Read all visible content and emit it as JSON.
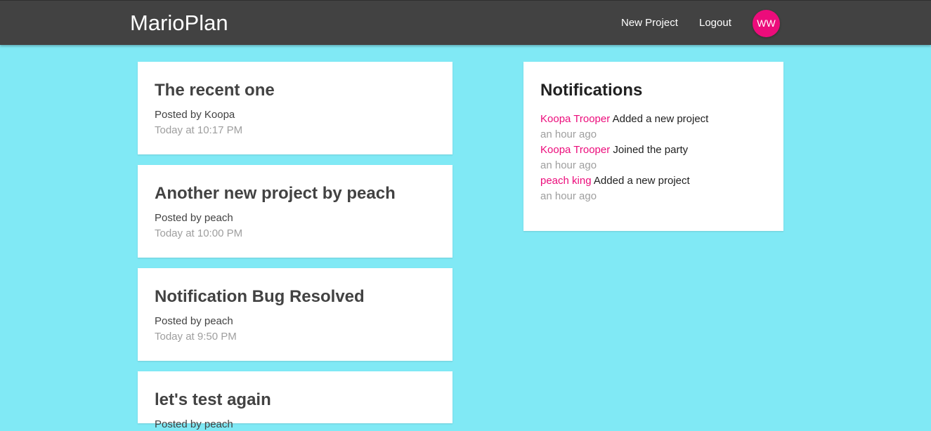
{
  "navbar": {
    "brand": "MarioPlan",
    "links": {
      "new_project": "New Project",
      "logout": "Logout"
    },
    "avatar_initials": "WW",
    "colors": {
      "background": "#424242",
      "avatar": "#ec0c7b"
    }
  },
  "projects": [
    {
      "title": "The recent one",
      "author": "Posted by Koopa",
      "date": "Today at 10:17 PM"
    },
    {
      "title": "Another new project by peach",
      "author": "Posted by peach",
      "date": "Today at 10:00 PM"
    },
    {
      "title": "Notification Bug Resolved",
      "author": "Posted by peach",
      "date": "Today at 9:50 PM"
    },
    {
      "title": "let's test again",
      "author": "Posted by peach",
      "date": ""
    }
  ],
  "notifications": {
    "title": "Notifications",
    "items": [
      {
        "user": "Koopa Trooper",
        "content": "Added a new project",
        "time": "an hour ago"
      },
      {
        "user": "Koopa Trooper",
        "content": "Joined the party",
        "time": "an hour ago"
      },
      {
        "user": "peach king",
        "content": "Added a new project",
        "time": "an hour ago"
      }
    ]
  },
  "theme": {
    "page_background": "#80e9f5",
    "accent": "#ec0c7b"
  }
}
